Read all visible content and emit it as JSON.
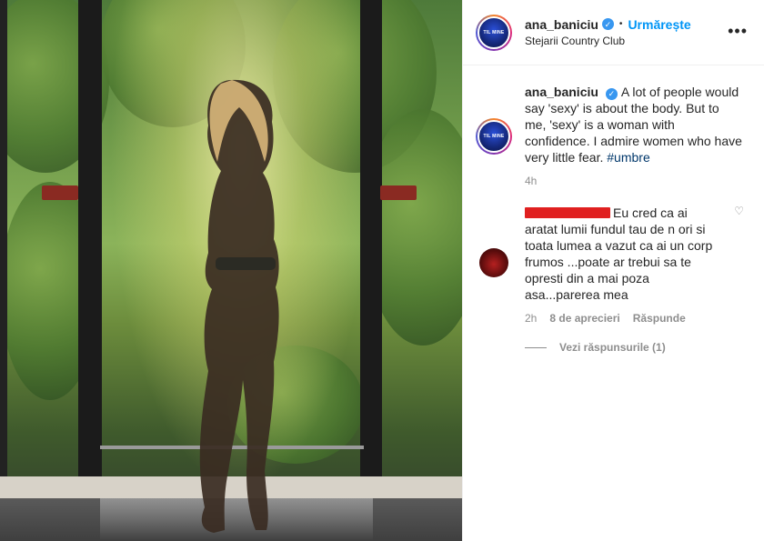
{
  "post": {
    "image_alt": "Woman standing in front of a window overlooking a forest",
    "header": {
      "username": "ana_baniciu",
      "follow_label": "Urmărește",
      "location": "Stejarii Country Club",
      "avatar_text": "TIL MINE",
      "more_icon": "more-icon"
    },
    "caption": {
      "username": "ana_baniciu",
      "text": "A lot of people would say 'sexy' is about the body. But to me, 'sexy' is a woman with confidence. I admire women who have very little fear.",
      "hashtag": "#umbre",
      "time": "4h"
    },
    "comments": [
      {
        "text": "Eu cred ca ai aratat lumii fundul tau de n ori si toata lumea a vazut ca ai un corp frumos ...poate ar trebui sa te opresti din a mai poza asa...parerea mea",
        "time": "2h",
        "likes": "8 de aprecieri",
        "reply_label": "Răspunde",
        "view_replies": "Vezi răspunsurile (1)"
      }
    ]
  },
  "colors": {
    "link_blue": "#0095f6",
    "verified_blue": "#3897f0",
    "hashtag": "#00376b",
    "secondary_text": "#8e8e8e",
    "redaction": "#e02020"
  }
}
